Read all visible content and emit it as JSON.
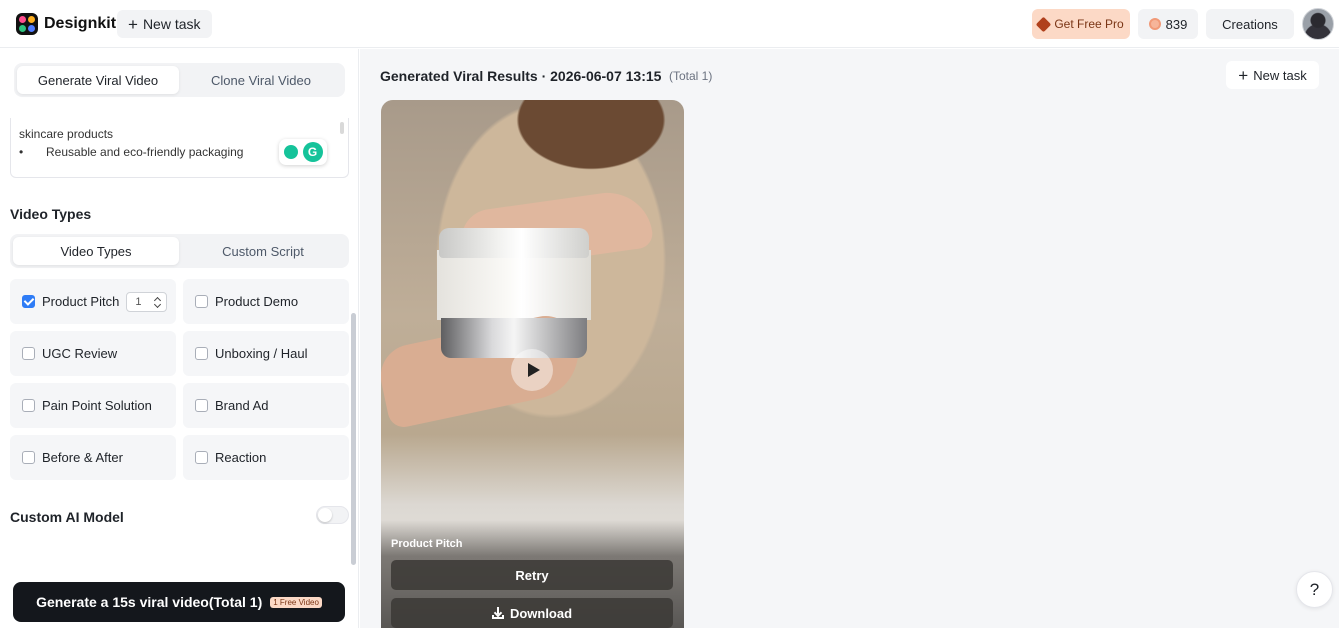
{
  "header": {
    "logo_text": "Designkit",
    "new_task_label": "New task",
    "get_pro_label": "Get Free Pro",
    "credits": "839",
    "creations_label": "Creations"
  },
  "sidebar": {
    "mode_tabs": [
      "Generate Viral Video",
      "Clone Viral Video"
    ],
    "active_mode": "Generate Viral Video",
    "description_lines": [
      "skincare products",
      "Reusable and eco-friendly packaging"
    ],
    "description_bullet": "•",
    "grammarly_letter": "G",
    "video_types_title": "Video Types",
    "video_type_tabs": [
      "Video Types",
      "Custom Script"
    ],
    "video_types": [
      {
        "label": "Product Pitch",
        "checked": true,
        "count": "1"
      },
      {
        "label": "Product Demo",
        "checked": false
      },
      {
        "label": "UGC Review",
        "checked": false
      },
      {
        "label": "Unboxing / Haul",
        "checked": false
      },
      {
        "label": "Pain Point Solution",
        "checked": false
      },
      {
        "label": "Brand Ad",
        "checked": false
      },
      {
        "label": "Before & After",
        "checked": false
      },
      {
        "label": "Reaction",
        "checked": false
      }
    ],
    "custom_ai_model_label": "Custom AI Model",
    "custom_ai_model_enabled": false,
    "generate_button_label": "Generate a 15s viral video(Total 1)",
    "free_badge": "1 Free Video"
  },
  "main": {
    "results_title": "Generated Viral Results · 2026-06-07 13:15",
    "results_total": "(Total 1)",
    "new_task_label": "New task",
    "video_card": {
      "label": "Product Pitch",
      "retry_label": "Retry",
      "download_label": "Download"
    },
    "help_label": "?"
  },
  "colors": {
    "primary_button": "#14171c",
    "pro_badge": "#fcd9c6",
    "checkbox_accent": "#2e7cf6"
  },
  "icons": [
    "plus-icon",
    "diamond-icon",
    "coin-icon",
    "play-icon",
    "download-icon",
    "help-icon"
  ]
}
